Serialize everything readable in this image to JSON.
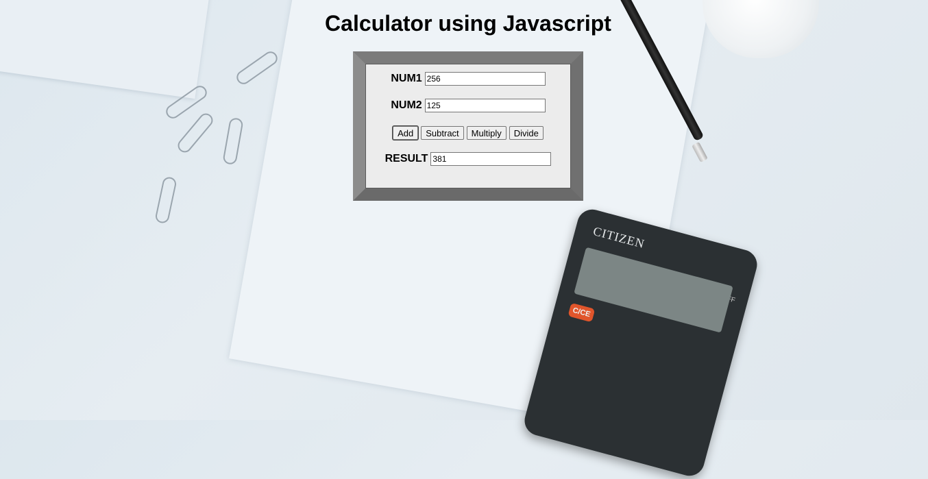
{
  "page": {
    "title": "Calculator using Javascript"
  },
  "calculator": {
    "num1": {
      "label": "NUM1",
      "value": "256"
    },
    "num2": {
      "label": "NUM2",
      "value": "125"
    },
    "buttons": {
      "add": "Add",
      "subtract": "Subtract",
      "multiply": "Multiply",
      "divide": "Divide"
    },
    "result": {
      "label": "RESULT",
      "value": "381"
    }
  },
  "background": {
    "calculator_brand": "CITIZEN",
    "calculator_model": "LC-210NR AUTO POWER OFF"
  }
}
